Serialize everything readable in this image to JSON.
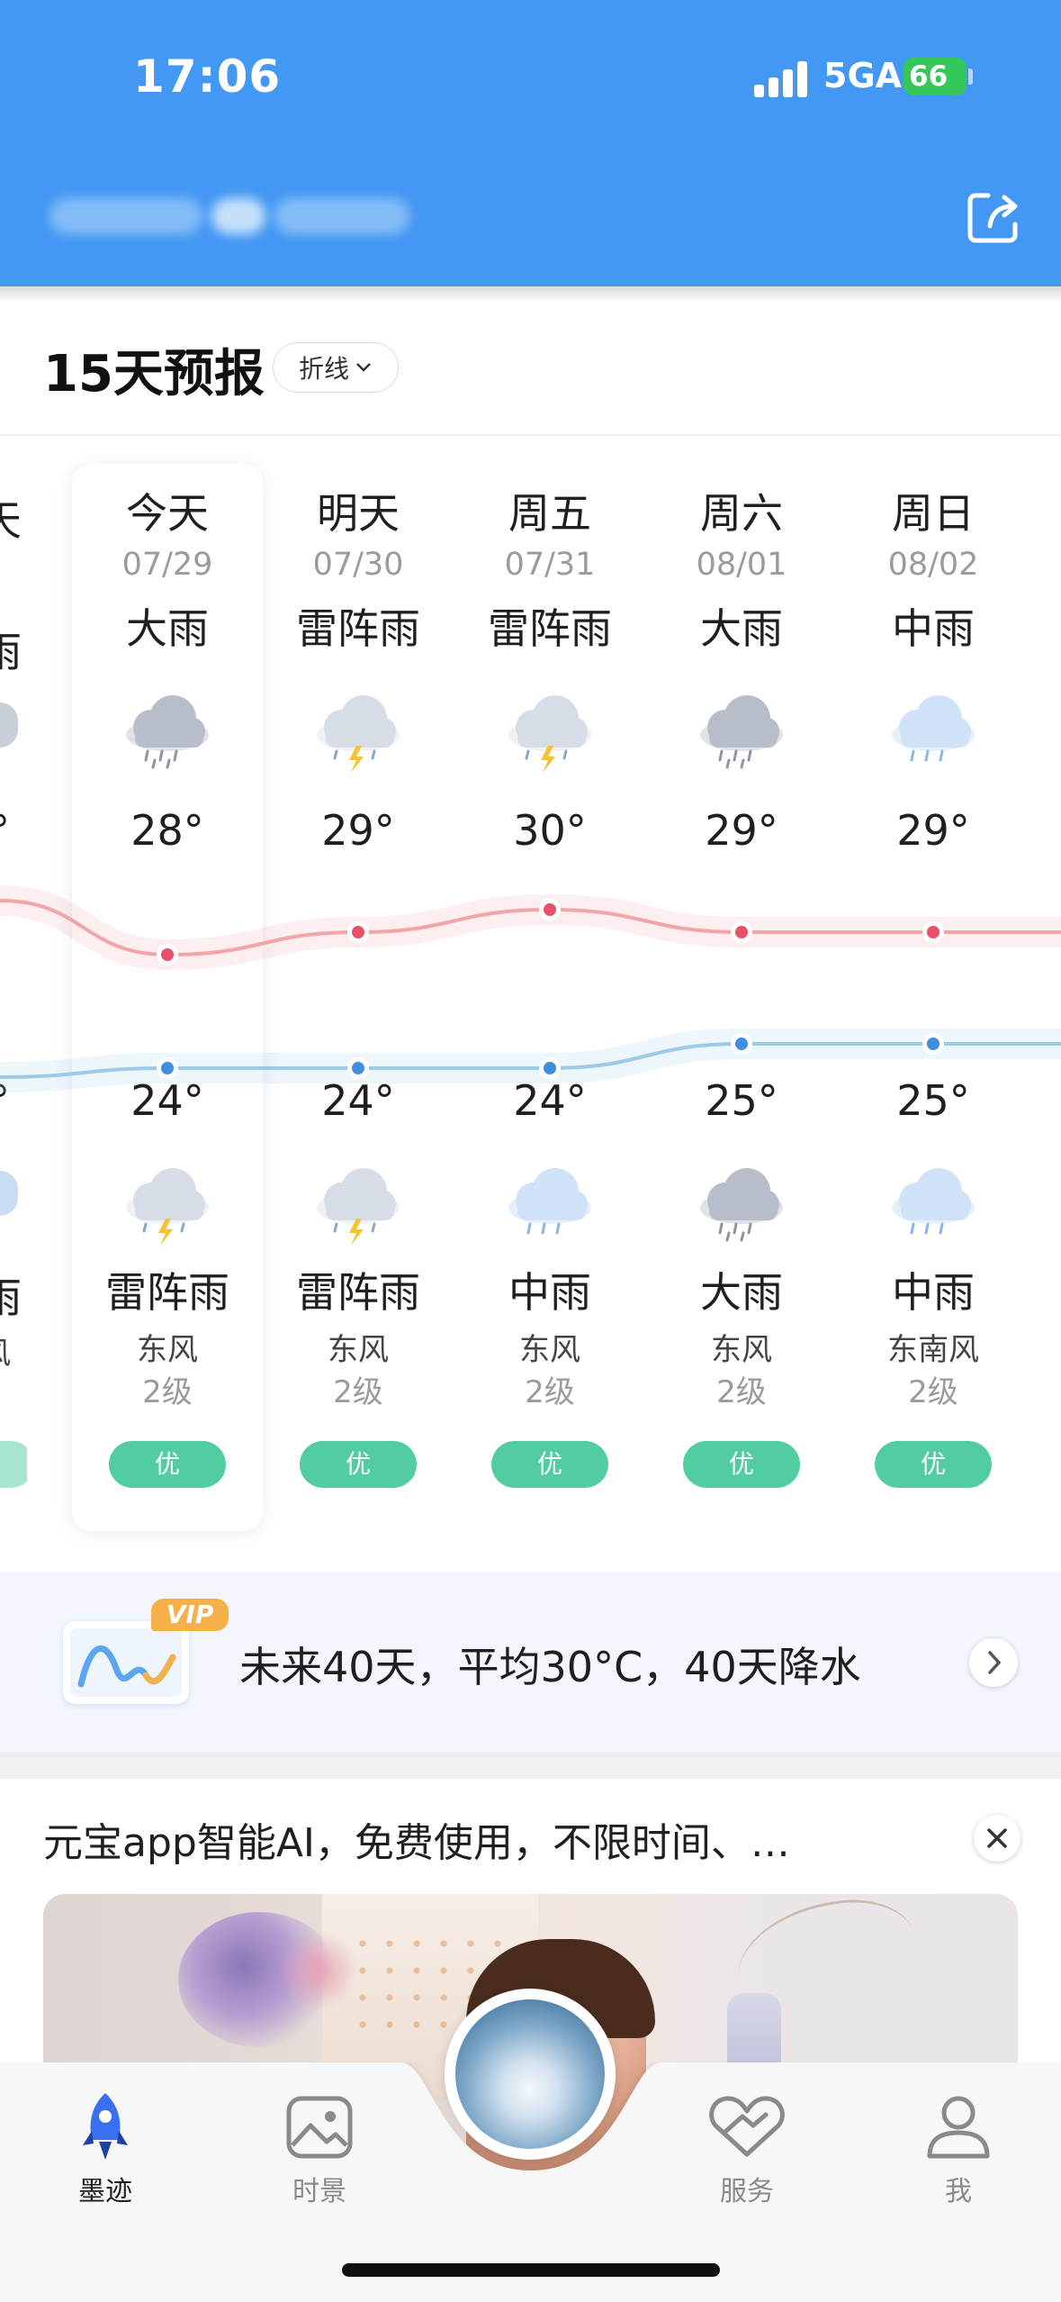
{
  "status_bar": {
    "time": "17:06",
    "network": "5GA",
    "battery": "66"
  },
  "forecast": {
    "title": "15天预报",
    "mode": "折线",
    "days": [
      {
        "name": "今天",
        "date": "07/29",
        "day_weather": "大雨",
        "day_icon": "heavy-rain-icon",
        "high": "28°",
        "low": "24°",
        "night_icon": "thunder-rain-icon",
        "night_weather": "雷阵雨",
        "wind": "东风",
        "wind_level": "2级",
        "aqi": "优"
      },
      {
        "name": "明天",
        "date": "07/30",
        "day_weather": "雷阵雨",
        "day_icon": "thunder-rain-icon",
        "high": "29°",
        "low": "24°",
        "night_icon": "thunder-rain-icon",
        "night_weather": "雷阵雨",
        "wind": "东风",
        "wind_level": "2级",
        "aqi": "优"
      },
      {
        "name": "周五",
        "date": "07/31",
        "day_weather": "雷阵雨",
        "day_icon": "thunder-rain-icon",
        "high": "30°",
        "low": "24°",
        "night_icon": "moderate-rain-icon",
        "night_weather": "中雨",
        "wind": "东风",
        "wind_level": "2级",
        "aqi": "优"
      },
      {
        "name": "周六",
        "date": "08/01",
        "day_weather": "大雨",
        "day_icon": "heavy-rain-icon",
        "high": "29°",
        "low": "25°",
        "night_icon": "heavy-rain-icon",
        "night_weather": "大雨",
        "wind": "东风",
        "wind_level": "2级",
        "aqi": "优"
      },
      {
        "name": "周日",
        "date": "08/02",
        "day_weather": "中雨",
        "day_icon": "moderate-rain-icon",
        "high": "29°",
        "low": "25°",
        "night_icon": "moderate-rain-icon",
        "night_weather": "中雨",
        "wind": "东南风",
        "wind_level": "2级",
        "aqi": "优"
      }
    ],
    "colors": {
      "high_line": "#f2a5a8",
      "high_dot": "#e8506a",
      "low_line": "#9ccbe8",
      "low_dot": "#3f8ee0",
      "aqi": "#52cda0"
    }
  },
  "vip_banner": {
    "badge": "VIP",
    "text": "未来40天，平均30°C，40天降水"
  },
  "ad": {
    "title": "元宝app智能AI，免费使用，不限时间、…"
  },
  "tabbar": {
    "items": [
      {
        "label": "墨迹",
        "icon": "rocket-icon"
      },
      {
        "label": "时景",
        "icon": "photo-icon"
      },
      {
        "label": "服务",
        "icon": "service-heart-icon"
      },
      {
        "label": "我",
        "icon": "user-icon"
      }
    ]
  }
}
